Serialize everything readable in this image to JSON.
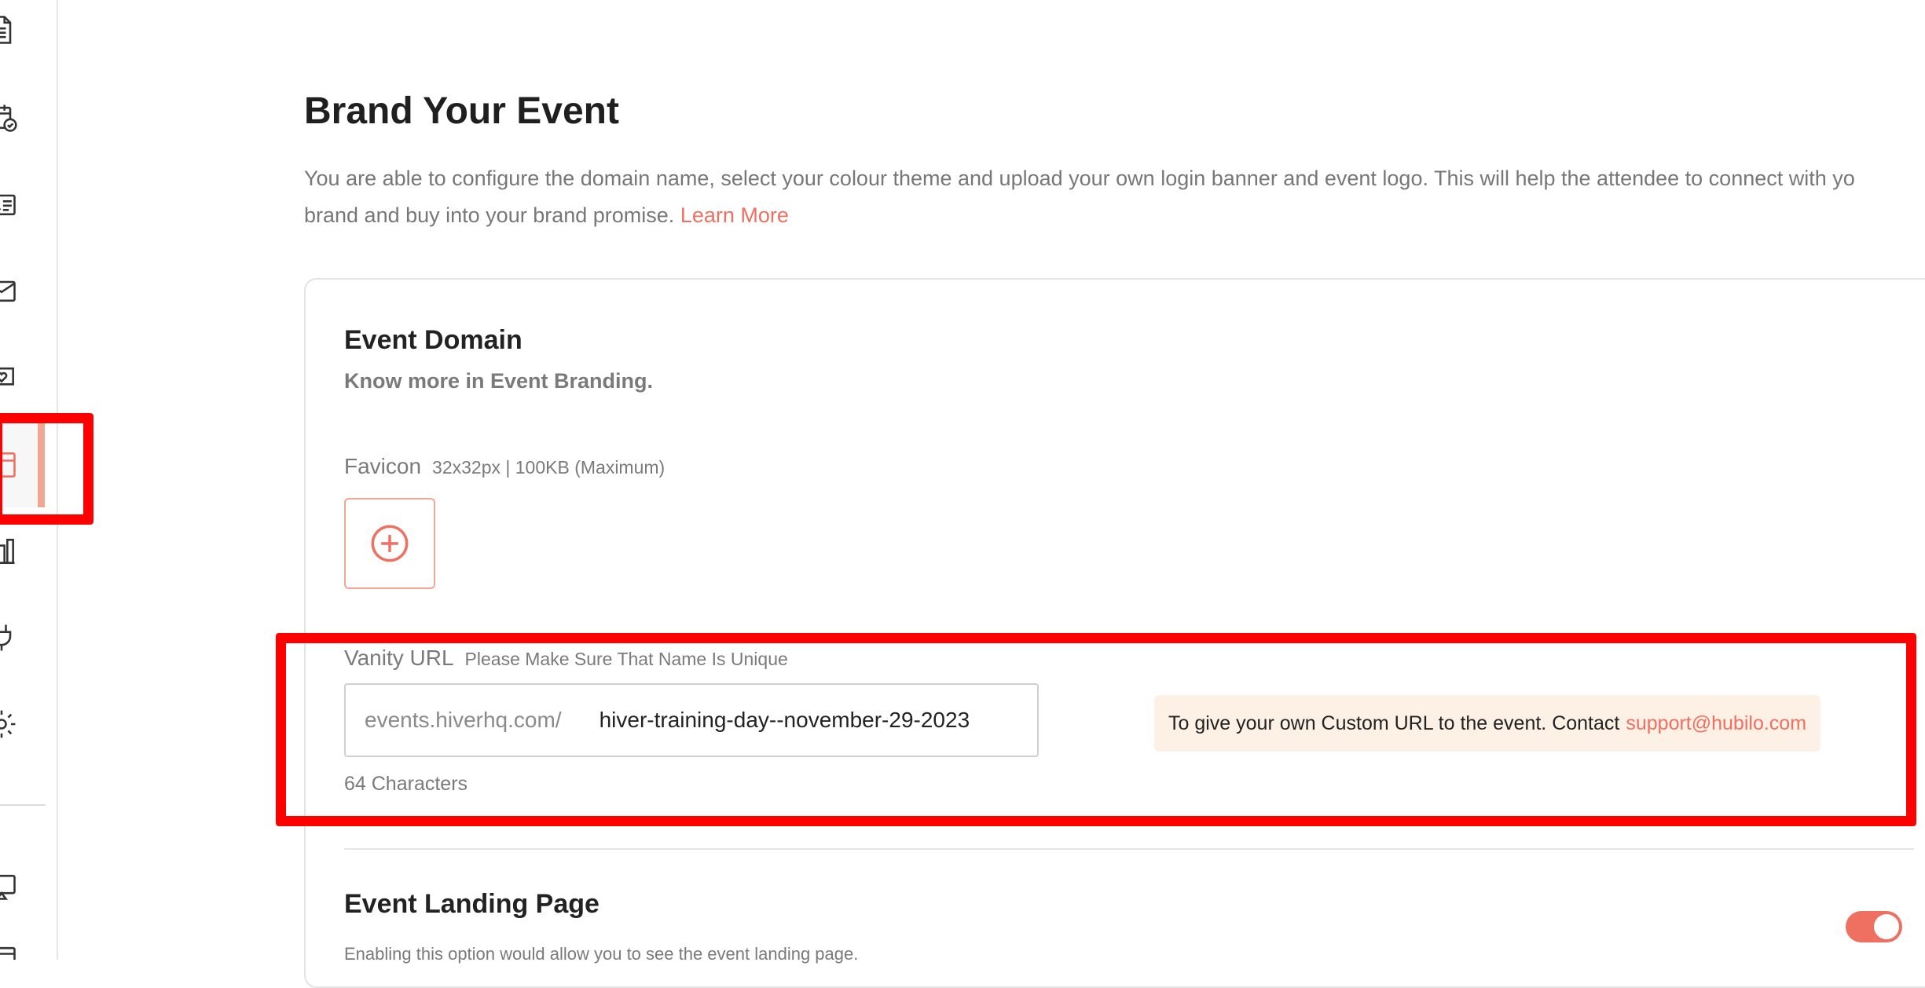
{
  "sidebar": {
    "icons": [
      "document-icon",
      "calendar-check-icon",
      "id-card-icon",
      "mail-icon",
      "chat-heart-icon",
      "layout-icon",
      "bar-chart-icon",
      "plug-icon",
      "gear-icon",
      "cast-icon",
      "window-icon"
    ],
    "active": "layout-icon"
  },
  "page": {
    "title": "Brand Your Event",
    "description_line1": "You are able to configure the domain name, select your colour theme and upload your own login banner and event logo. This will help the attendee to connect with yo",
    "description_line2": "brand and buy into your brand promise.",
    "learn_more": "Learn More"
  },
  "event_domain": {
    "title": "Event Domain",
    "subtitle": "Know more in Event Branding.",
    "favicon_label": "Favicon",
    "favicon_hint": "32x32px | 100KB (Maximum)",
    "vanity_label": "Vanity URL",
    "vanity_hint": "Please Make Sure That Name Is Unique",
    "vanity_prefix": "events.hiverhq.com/",
    "vanity_value": "hiver-training-day--november-29-2023",
    "note_text": "To give your own Custom URL to the event. Contact",
    "note_email": "support@hubilo.com",
    "char_count": "64 Characters"
  },
  "landing": {
    "title": "Event Landing Page",
    "subtitle": "Enabling this option would allow you to see the event landing page.",
    "enabled": true
  },
  "colors": {
    "accent": "#ef6f60",
    "highlight": "#ff0000",
    "note_bg": "#fdf1e6"
  }
}
